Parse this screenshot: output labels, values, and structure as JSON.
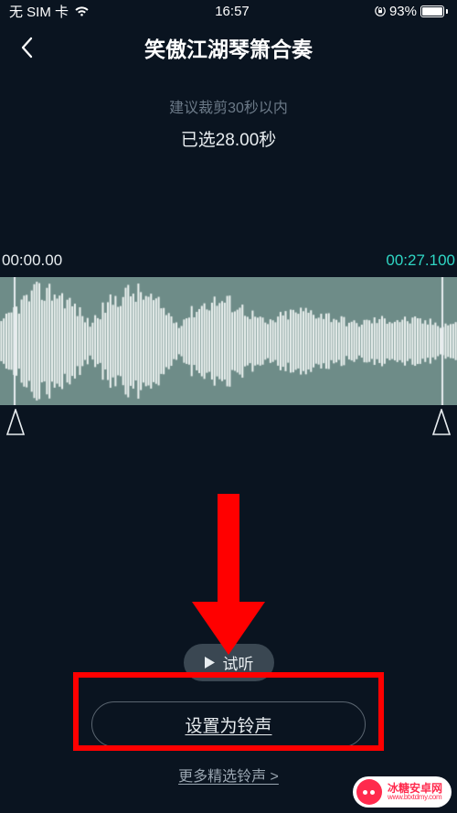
{
  "status": {
    "carrier": "无 SIM 卡",
    "time": "16:57",
    "battery_pct": "93%"
  },
  "nav": {
    "title": "笑傲江湖琴箫合奏"
  },
  "editor": {
    "hint": "建议裁剪30秒以内",
    "selected_label": "已选28.00秒",
    "start_time": "00:00.00",
    "end_time": "00:27.100"
  },
  "actions": {
    "preview_label": "试听",
    "set_ringtone_label": "设置为铃声",
    "more_label": "更多精选铃声 >"
  },
  "watermark": {
    "brand": "冰糖安卓网",
    "url": "www.btxtdmy.com"
  },
  "colors": {
    "accent": "#2fd6c4",
    "wave_bg": "#6e8c88",
    "annotation": "#ff0000"
  }
}
